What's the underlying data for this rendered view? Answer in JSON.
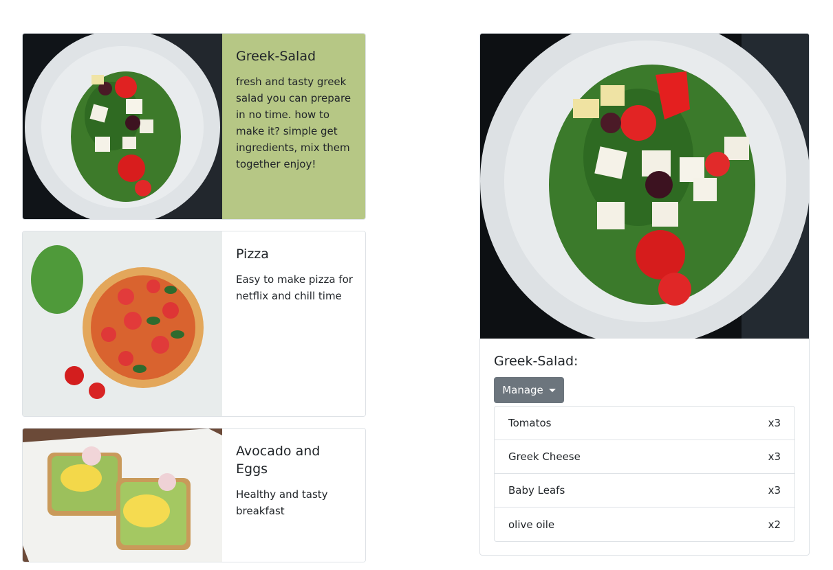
{
  "recipes": [
    {
      "name": "Greek-Salad",
      "description": "fresh and tasty greek salad you can prepare in no time. how to make it? simple get ingredients, mix them together enjoy!",
      "image": "greek-salad-photo",
      "active": true
    },
    {
      "name": "Pizza",
      "description": "Easy to make pizza for netflix and chill time",
      "image": "pizza-photo",
      "active": false
    },
    {
      "name": "Avocado and Eggs",
      "description": "Healthy and tasty breakfast",
      "image": "avocado-eggs-photo",
      "active": false
    }
  ],
  "detail": {
    "title": "Greek-Salad:",
    "manage_label": "Manage",
    "ingredients": [
      {
        "name": "Tomatos",
        "amount": "x3"
      },
      {
        "name": "Greek Cheese",
        "amount": "x3"
      },
      {
        "name": "Baby Leafs",
        "amount": "x3"
      },
      {
        "name": "olive oile",
        "amount": "x2"
      }
    ]
  },
  "colors": {
    "active_card_bg": "#b6c785",
    "button_bg": "#6c757d",
    "border": "#dee2e6"
  }
}
